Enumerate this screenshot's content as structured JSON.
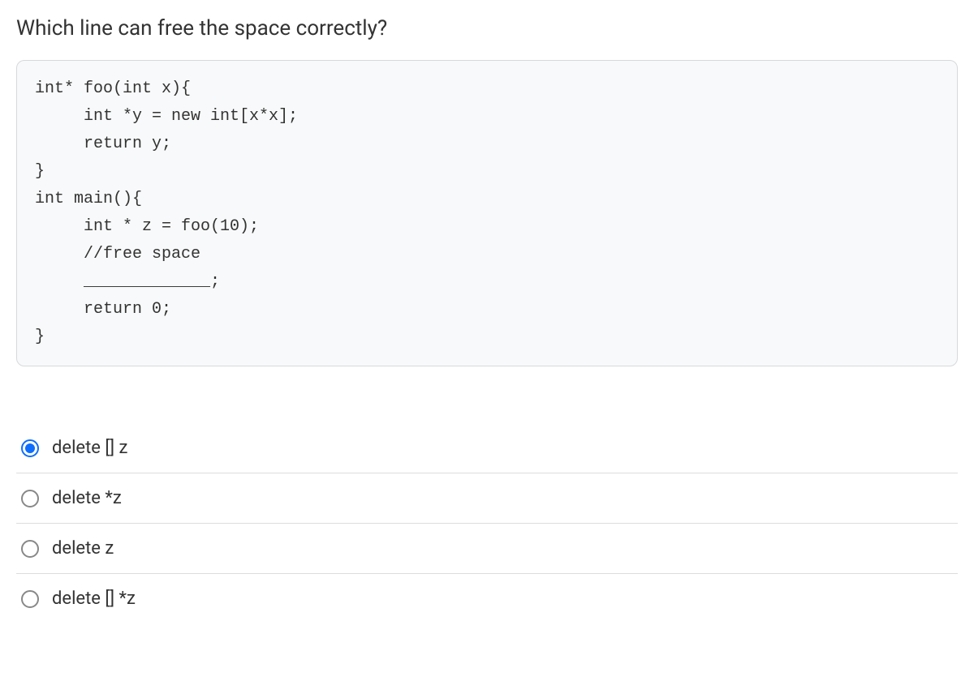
{
  "question": "Which line can free the space correctly?",
  "code": "int* foo(int x){\n     int *y = new int[x*x];\n     return y;\n}\nint main(){\n     int * z = foo(10);\n     //free space\n     _____________;\n     return 0;\n}",
  "options": [
    {
      "label": "delete [] z",
      "selected": true
    },
    {
      "label": "delete *z",
      "selected": false
    },
    {
      "label": "delete z",
      "selected": false
    },
    {
      "label": "delete [] *z",
      "selected": false
    }
  ]
}
